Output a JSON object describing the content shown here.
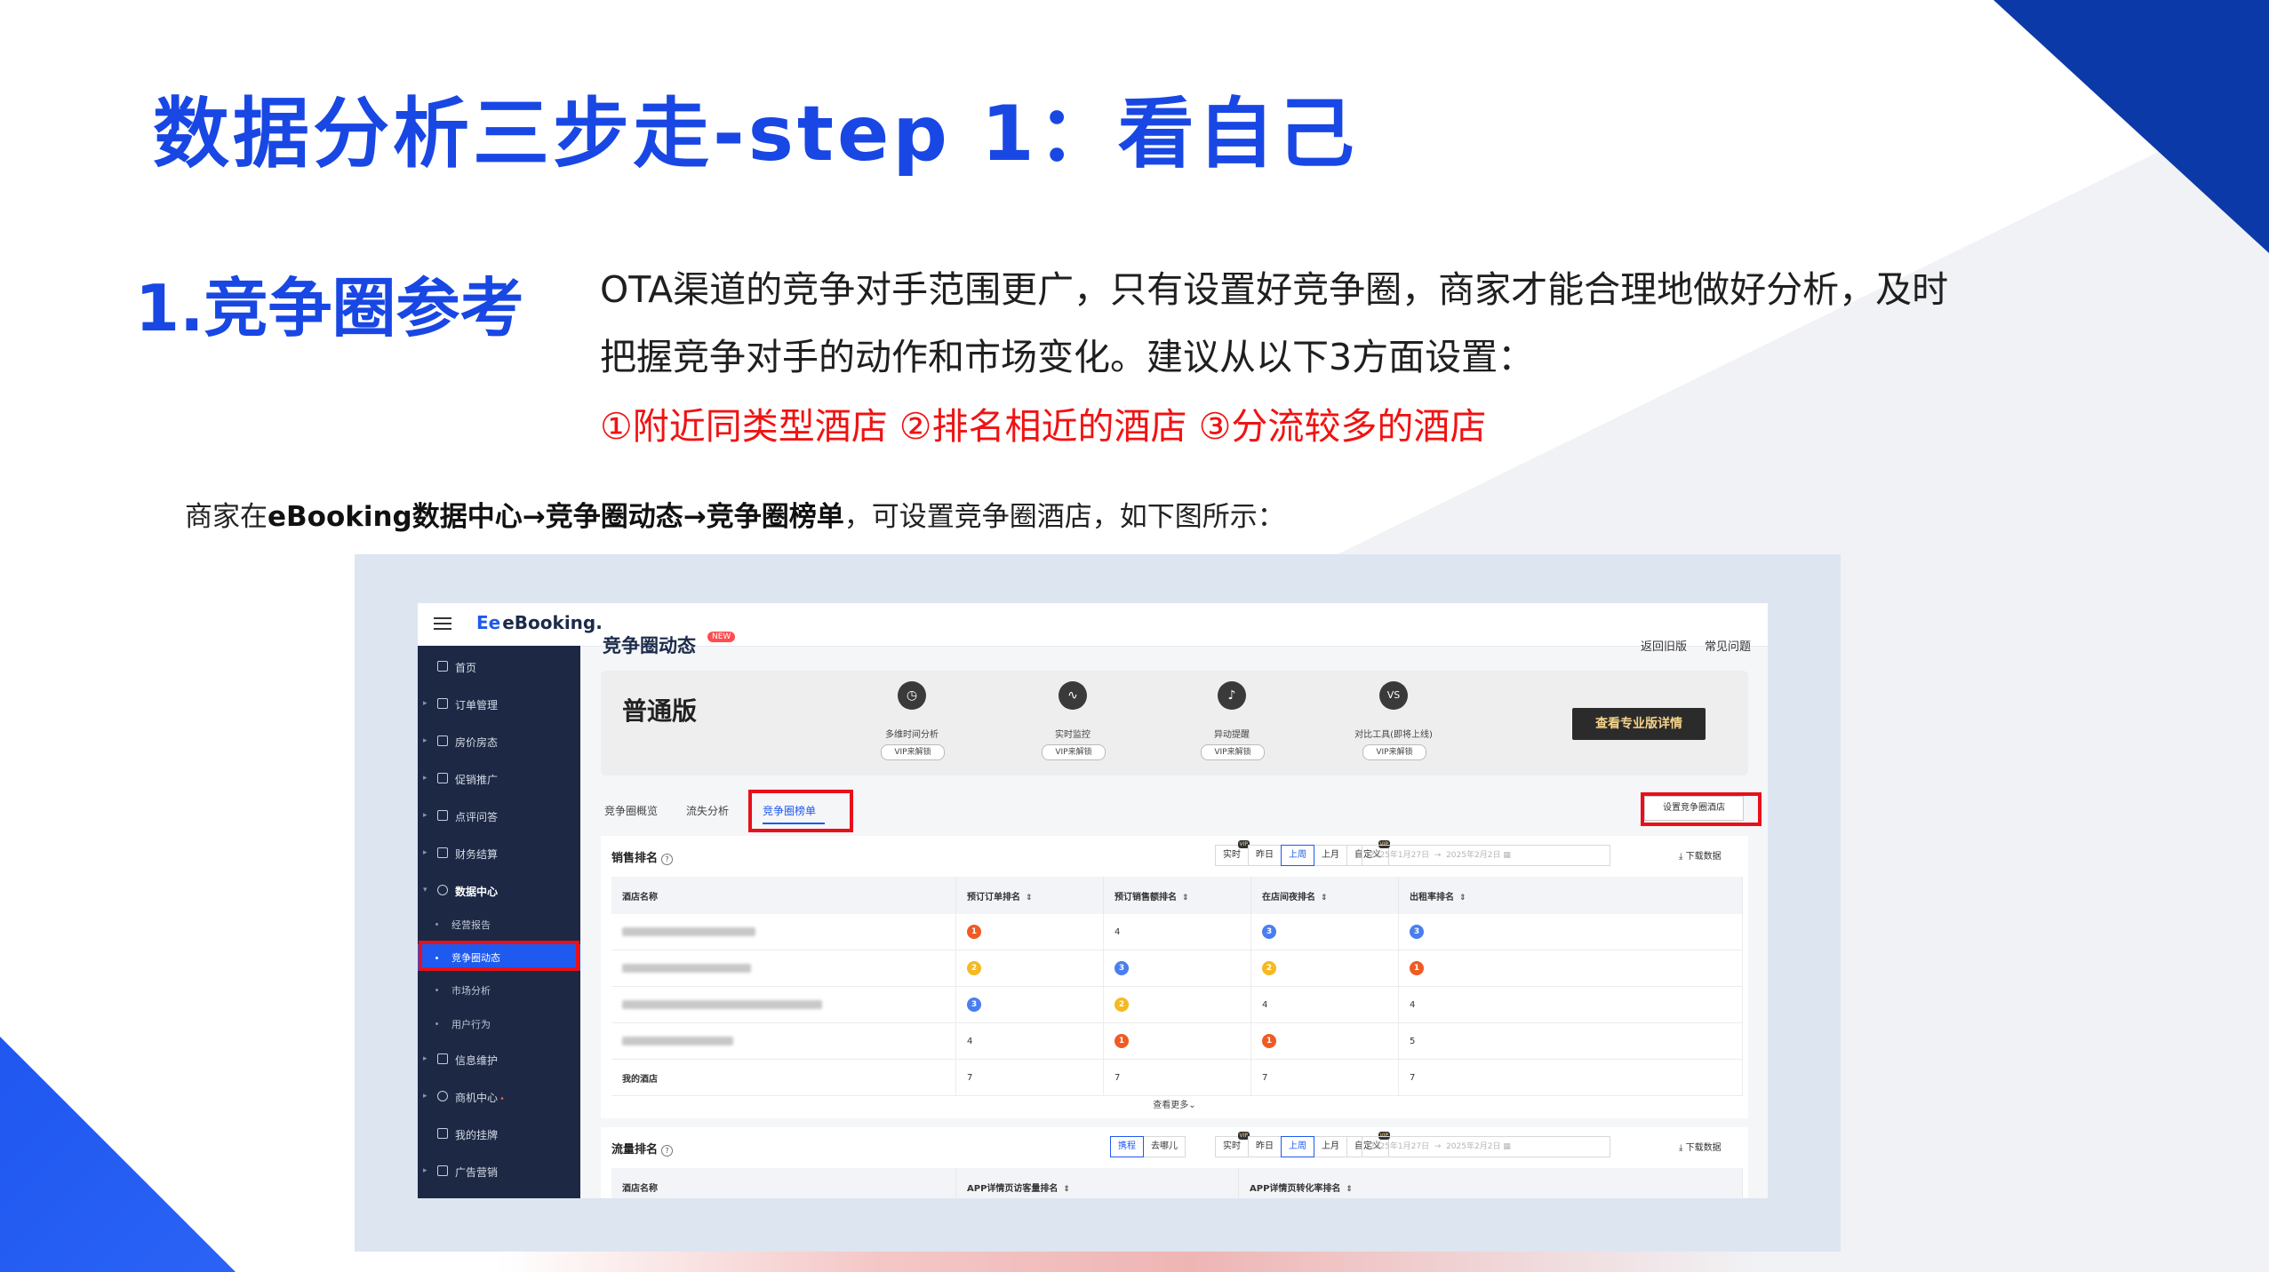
{
  "slide": {
    "title": "数据分析三步走-step 1：看自己",
    "section_heading": "1.竞争圈参考",
    "paragraph_line1": "OTA渠道的竞争对手范围更广，只有设置好竞争圈，商家才能合理地做好分析，及时",
    "paragraph_line2": "把握竞争对手的动作和市场变化。建议从以下3方面设置：",
    "paragraph_line3": "①附近同类型酒店 ②排名相近的酒店 ③分流较多的酒店",
    "caption_prefix": "商家在",
    "caption_bold": "eBooking数据中心→竞争圈动态→竞争圈榜单",
    "caption_suffix": "，可设置竞争圈酒店，如下图所示：",
    "colors": {
      "title_blue": "#1847e4",
      "highlight_red": "#f01313",
      "accent_navy": "#0b3aa8"
    }
  },
  "app": {
    "logo_text": "eBooking.",
    "logo_mark": "Ee",
    "sidebar": {
      "items": [
        {
          "label": "首页",
          "icon": "home-icon"
        },
        {
          "label": "订单管理",
          "icon": "order-icon"
        },
        {
          "label": "房价房态",
          "icon": "room-icon"
        },
        {
          "label": "促销推广",
          "icon": "promotion-icon"
        },
        {
          "label": "点评问答",
          "icon": "review-icon"
        },
        {
          "label": "财务结算",
          "icon": "finance-icon"
        },
        {
          "label": "数据中心",
          "icon": "chart-icon"
        }
      ],
      "sub_items": [
        {
          "label": "经营报告"
        },
        {
          "label": "竞争圈动态"
        },
        {
          "label": "市场分析"
        },
        {
          "label": "用户行为"
        }
      ],
      "items_after": [
        {
          "label": "信息维护",
          "icon": "info-icon"
        },
        {
          "label": "商机中心",
          "icon": "business-icon",
          "dot": "•"
        },
        {
          "label": "我的挂牌",
          "icon": "listing-icon"
        },
        {
          "label": "广告营销",
          "icon": "ad-icon"
        }
      ]
    },
    "page_title": "竞争圈动态",
    "new_badge": "NEW",
    "header_links": {
      "back": "返回旧版",
      "faq": "常见问题"
    },
    "edition": {
      "name": "普通版",
      "features": [
        {
          "name": "多维时间分析",
          "vip": "VIP来解锁",
          "icon": "calendar-icon",
          "glyph": "◷"
        },
        {
          "name": "实时监控",
          "vip": "VIP来解锁",
          "icon": "monitor-icon",
          "glyph": "∿"
        },
        {
          "name": "异动提醒",
          "vip": "VIP来解锁",
          "icon": "bell-icon",
          "glyph": "♪"
        },
        {
          "name": "对比工具(即将上线)",
          "vip": "VIP来解锁",
          "icon": "vs-icon",
          "glyph": "VS"
        }
      ],
      "pro_button": "查看专业版详情"
    },
    "tabs": [
      "竞争圈概览",
      "流失分析",
      "竞争圈榜单"
    ],
    "set_circle_button": "设置竞争圈酒店",
    "sales_panel": {
      "title": "销售排名",
      "controls": [
        {
          "label": "实时",
          "vip": "VIP"
        },
        {
          "label": "昨日"
        },
        {
          "label": "上周",
          "active": true
        },
        {
          "label": "上月"
        },
        {
          "label": "自定义",
          "vip": "VIP"
        }
      ],
      "date_start": "2025年1月27日",
      "date_end": "2025年2月2日",
      "download": "下载数据",
      "columns": [
        "酒店名称",
        "预订订单排名",
        "预订销售额排名",
        "在店间夜排名",
        "出租率排名"
      ],
      "rows": [
        {
          "name": "",
          "ranks": [
            "1",
            "4",
            "3",
            "3"
          ]
        },
        {
          "name": "",
          "ranks": [
            "2",
            "3",
            "2",
            "1"
          ]
        },
        {
          "name": "",
          "ranks": [
            "3",
            "2",
            "4",
            "4"
          ]
        },
        {
          "name": "",
          "ranks": [
            "4",
            "1",
            "1",
            "5"
          ]
        },
        {
          "name": "我的酒店",
          "ranks": [
            "7",
            "7",
            "7",
            "7"
          ]
        }
      ],
      "more": "查看更多⌄"
    },
    "traffic_panel": {
      "title": "流量排名",
      "source_tabs": [
        {
          "label": "携程",
          "active": true
        },
        {
          "label": "去哪儿"
        }
      ],
      "controls": [
        {
          "label": "实时",
          "vip": "VIP"
        },
        {
          "label": "昨日"
        },
        {
          "label": "上周",
          "active": true
        },
        {
          "label": "上月"
        },
        {
          "label": "自定义",
          "vip": "VIP"
        }
      ],
      "date_start": "2025年1月27日",
      "date_end": "2025年2月2日",
      "download": "下载数据",
      "columns": [
        "酒店名称",
        "APP详情页访客量排名",
        "APP详情页转化率排名"
      ]
    }
  }
}
